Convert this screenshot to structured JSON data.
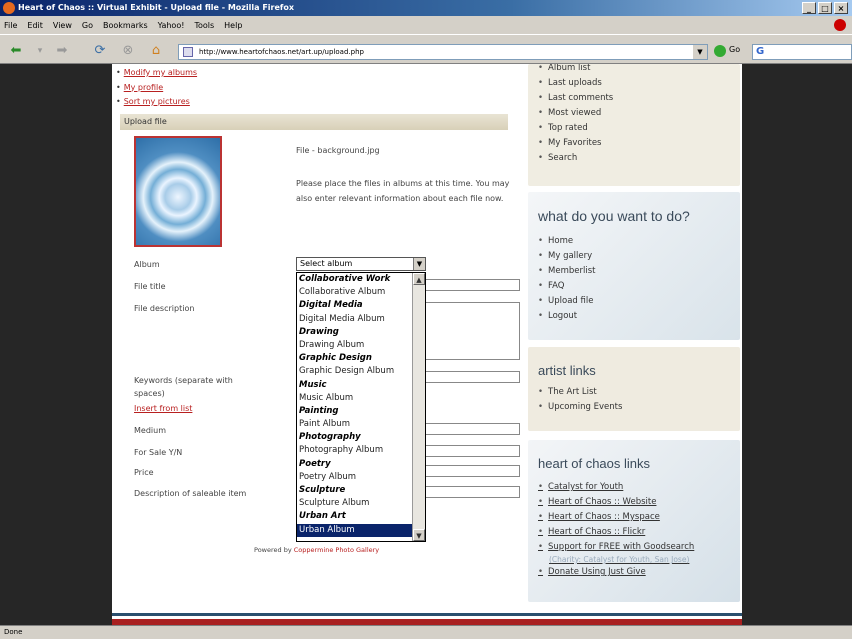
{
  "window": {
    "title": "Heart of Chaos :: Virtual Exhibit - Upload file - Mozilla Firefox",
    "buttons": [
      "_",
      "□",
      "×"
    ]
  },
  "menu": [
    "File",
    "Edit",
    "View",
    "Go",
    "Bookmarks",
    "Yahoo!",
    "Tools",
    "Help"
  ],
  "address": {
    "url": "http://www.heartofchaos.net/art.up/upload.php",
    "go_label": "Go",
    "search_logo": "G"
  },
  "status": "Done",
  "top_links": [
    "Modify my albums",
    "My profile",
    "Sort my pictures"
  ],
  "upload": {
    "header": "Upload file",
    "file_label": "File - background.jpg",
    "instructions": "Please place the files in albums at this time. You may also enter relevant information about each file now."
  },
  "form": {
    "album": "Album",
    "file_title": "File title",
    "file_description": "File description",
    "keywords": "Keywords (separate with spaces)",
    "insert_from_list": "Insert from list",
    "medium": "Medium",
    "for_sale": "For Sale Y/N",
    "price": "Price",
    "description_saleable": "Description of saleable item"
  },
  "album_select": {
    "value": "Select album",
    "options": [
      {
        "text": "Collaborative Work",
        "group": true
      },
      {
        "text": "Collaborative Album",
        "group": false
      },
      {
        "text": "Digital Media",
        "group": true
      },
      {
        "text": "Digital Media Album",
        "group": false
      },
      {
        "text": "Drawing",
        "group": true
      },
      {
        "text": "Drawing Album",
        "group": false
      },
      {
        "text": "Graphic Design",
        "group": true
      },
      {
        "text": "Graphic Design Album",
        "group": false
      },
      {
        "text": "Music",
        "group": true
      },
      {
        "text": "Music Album",
        "group": false
      },
      {
        "text": "Painting",
        "group": true
      },
      {
        "text": "Paint Album",
        "group": false
      },
      {
        "text": "Photography",
        "group": true
      },
      {
        "text": "Photography Album",
        "group": false
      },
      {
        "text": "Poetry",
        "group": true
      },
      {
        "text": "Poetry Album",
        "group": false
      },
      {
        "text": "Sculpture",
        "group": true
      },
      {
        "text": "Sculpture Album",
        "group": false
      },
      {
        "text": "Urban Art",
        "group": true
      },
      {
        "text": "Urban Album",
        "group": false,
        "selected": true
      }
    ]
  },
  "powered_by": {
    "prefix": "Powered by ",
    "link": "Coppermine Photo Gallery"
  },
  "sidebar": {
    "box1_items": [
      "Album list",
      "Last uploads",
      "Last comments",
      "Most viewed",
      "Top rated",
      "My Favorites",
      "Search"
    ],
    "box2_title": "what do you want to do?",
    "box2_items": [
      "Home",
      "My gallery",
      "Memberlist",
      "FAQ",
      "Upload file",
      "Logout"
    ],
    "box3_title": "artist links",
    "box3_items": [
      "The Art List",
      "Upcoming Events"
    ],
    "box4_title": "heart of chaos links",
    "box4_items": [
      "Catalyst for Youth",
      "Heart of Chaos :: Website",
      "Heart of Chaos :: Myspace",
      "Heart of Chaos :: Flickr",
      "Support for FREE with Goodsearch",
      "Donate Using Just Give"
    ],
    "box4_note": "(Charity: Catalyst for Youth, San Jose)"
  }
}
